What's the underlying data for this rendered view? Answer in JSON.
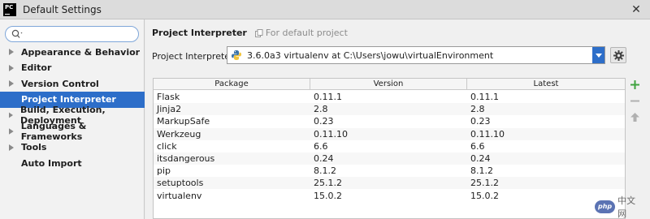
{
  "window": {
    "app_icon_text": "PC",
    "title": "Default Settings",
    "close_glyph": "✕"
  },
  "sidebar": {
    "search": {
      "placeholder": "",
      "value": ""
    },
    "items": [
      {
        "label": "Appearance & Behavior",
        "expandable": true,
        "selected": false
      },
      {
        "label": "Editor",
        "expandable": true,
        "selected": false
      },
      {
        "label": "Version Control",
        "expandable": true,
        "selected": false
      },
      {
        "label": "Project Interpreter",
        "expandable": false,
        "selected": true
      },
      {
        "label": "Build, Execution, Deployment",
        "expandable": true,
        "selected": false
      },
      {
        "label": "Languages & Frameworks",
        "expandable": true,
        "selected": false
      },
      {
        "label": "Tools",
        "expandable": true,
        "selected": false
      },
      {
        "label": "Auto Import",
        "expandable": false,
        "selected": false
      }
    ]
  },
  "main": {
    "title": "Project Interpreter",
    "subtitle": "For default project",
    "interpreter_label": "Project Interpreter:",
    "interpreter_value": "3.6.0a3 virtualenv at C:\\Users\\jowu\\virtualEnvironment"
  },
  "packages": {
    "columns": [
      "Package",
      "Version",
      "Latest"
    ],
    "rows": [
      [
        "Flask",
        "0.11.1",
        "0.11.1"
      ],
      [
        "Jinja2",
        "2.8",
        "2.8"
      ],
      [
        "MarkupSafe",
        "0.23",
        "0.23"
      ],
      [
        "Werkzeug",
        "0.11.10",
        "0.11.10"
      ],
      [
        "click",
        "6.6",
        "6.6"
      ],
      [
        "itsdangerous",
        "0.24",
        "0.24"
      ],
      [
        "pip",
        "8.1.2",
        "8.1.2"
      ],
      [
        "setuptools",
        "25.1.2",
        "25.1.2"
      ],
      [
        "virtualenv",
        "15.0.2",
        "15.0.2"
      ]
    ]
  },
  "tools": {
    "add_glyph": "+",
    "remove_glyph": "−"
  },
  "watermark": {
    "logo_text": "php",
    "text": "中文网"
  },
  "colors": {
    "selection": "#2d6ec9",
    "add_green": "#3fa33f"
  }
}
